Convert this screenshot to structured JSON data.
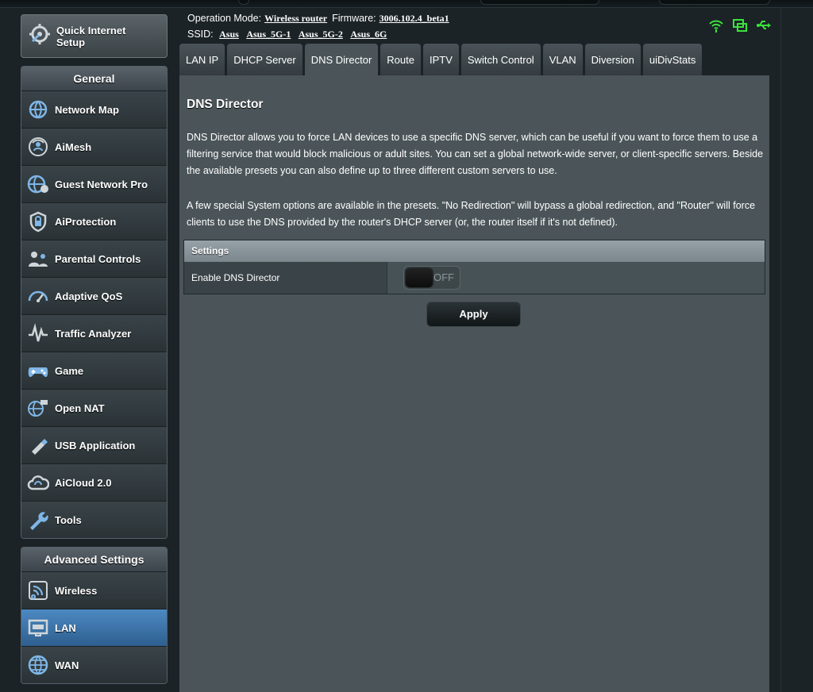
{
  "header": {
    "operation_mode_label": "Operation Mode:",
    "operation_mode_value": "Wireless router",
    "firmware_label": "Firmware:",
    "firmware_value": "3006.102.4_beta1",
    "ssid_label": "SSID:",
    "ssids": [
      "Asus",
      "Asus_5G-1",
      "Asus_5G-2",
      "Asus_6G"
    ]
  },
  "sidebar": {
    "quick_setup": "Quick Internet Setup",
    "general_title": "General",
    "general_items": [
      {
        "label": "Network Map",
        "icon": "network-map-icon"
      },
      {
        "label": "AiMesh",
        "icon": "aimesh-icon"
      },
      {
        "label": "Guest Network Pro",
        "icon": "guest-network-icon"
      },
      {
        "label": "AiProtection",
        "icon": "aiprotection-icon"
      },
      {
        "label": "Parental Controls",
        "icon": "parental-controls-icon"
      },
      {
        "label": "Adaptive QoS",
        "icon": "adaptive-qos-icon"
      },
      {
        "label": "Traffic Analyzer",
        "icon": "traffic-analyzer-icon"
      },
      {
        "label": "Game",
        "icon": "gamepad-icon"
      },
      {
        "label": "Open NAT",
        "icon": "open-nat-icon"
      },
      {
        "label": "USB Application",
        "icon": "usb-icon"
      },
      {
        "label": "AiCloud 2.0",
        "icon": "cloud-icon"
      },
      {
        "label": "Tools",
        "icon": "wrench-icon"
      }
    ],
    "advanced_title": "Advanced Settings",
    "advanced_items": [
      {
        "label": "Wireless",
        "icon": "wireless-icon"
      },
      {
        "label": "LAN",
        "icon": "lan-icon",
        "active": true
      },
      {
        "label": "WAN",
        "icon": "globe-icon"
      }
    ]
  },
  "tabs": [
    "LAN IP",
    "DHCP Server",
    "DNS Director",
    "Route",
    "IPTV",
    "Switch Control",
    "VLAN",
    "Diversion",
    "uiDivStats"
  ],
  "active_tab": "DNS Director",
  "main": {
    "title": "DNS Director",
    "paragraph1": "DNS Director allows you to force LAN devices to use a specific DNS server, which can be useful if you want to force them to use a filtering service that would block malicious or adult sites. You can set a global network-wide server, or client-specific servers. Beside the available presets you can also define up to three different custom servers to use.",
    "paragraph2": "A few special System options are available in the presets. \"No Redirection\" will bypass a global redirection, and \"Router\" will force clients to use the DNS provided by the router's DHCP server (or, the router itself if it's not defined).",
    "settings_header": "Settings",
    "enable_label": "Enable DNS Director",
    "toggle_state": "OFF",
    "apply_label": "Apply"
  },
  "colors": {
    "accent_active": "#3f78ae",
    "panel_bg": "#4b5559",
    "status_green": "#3de23d"
  }
}
